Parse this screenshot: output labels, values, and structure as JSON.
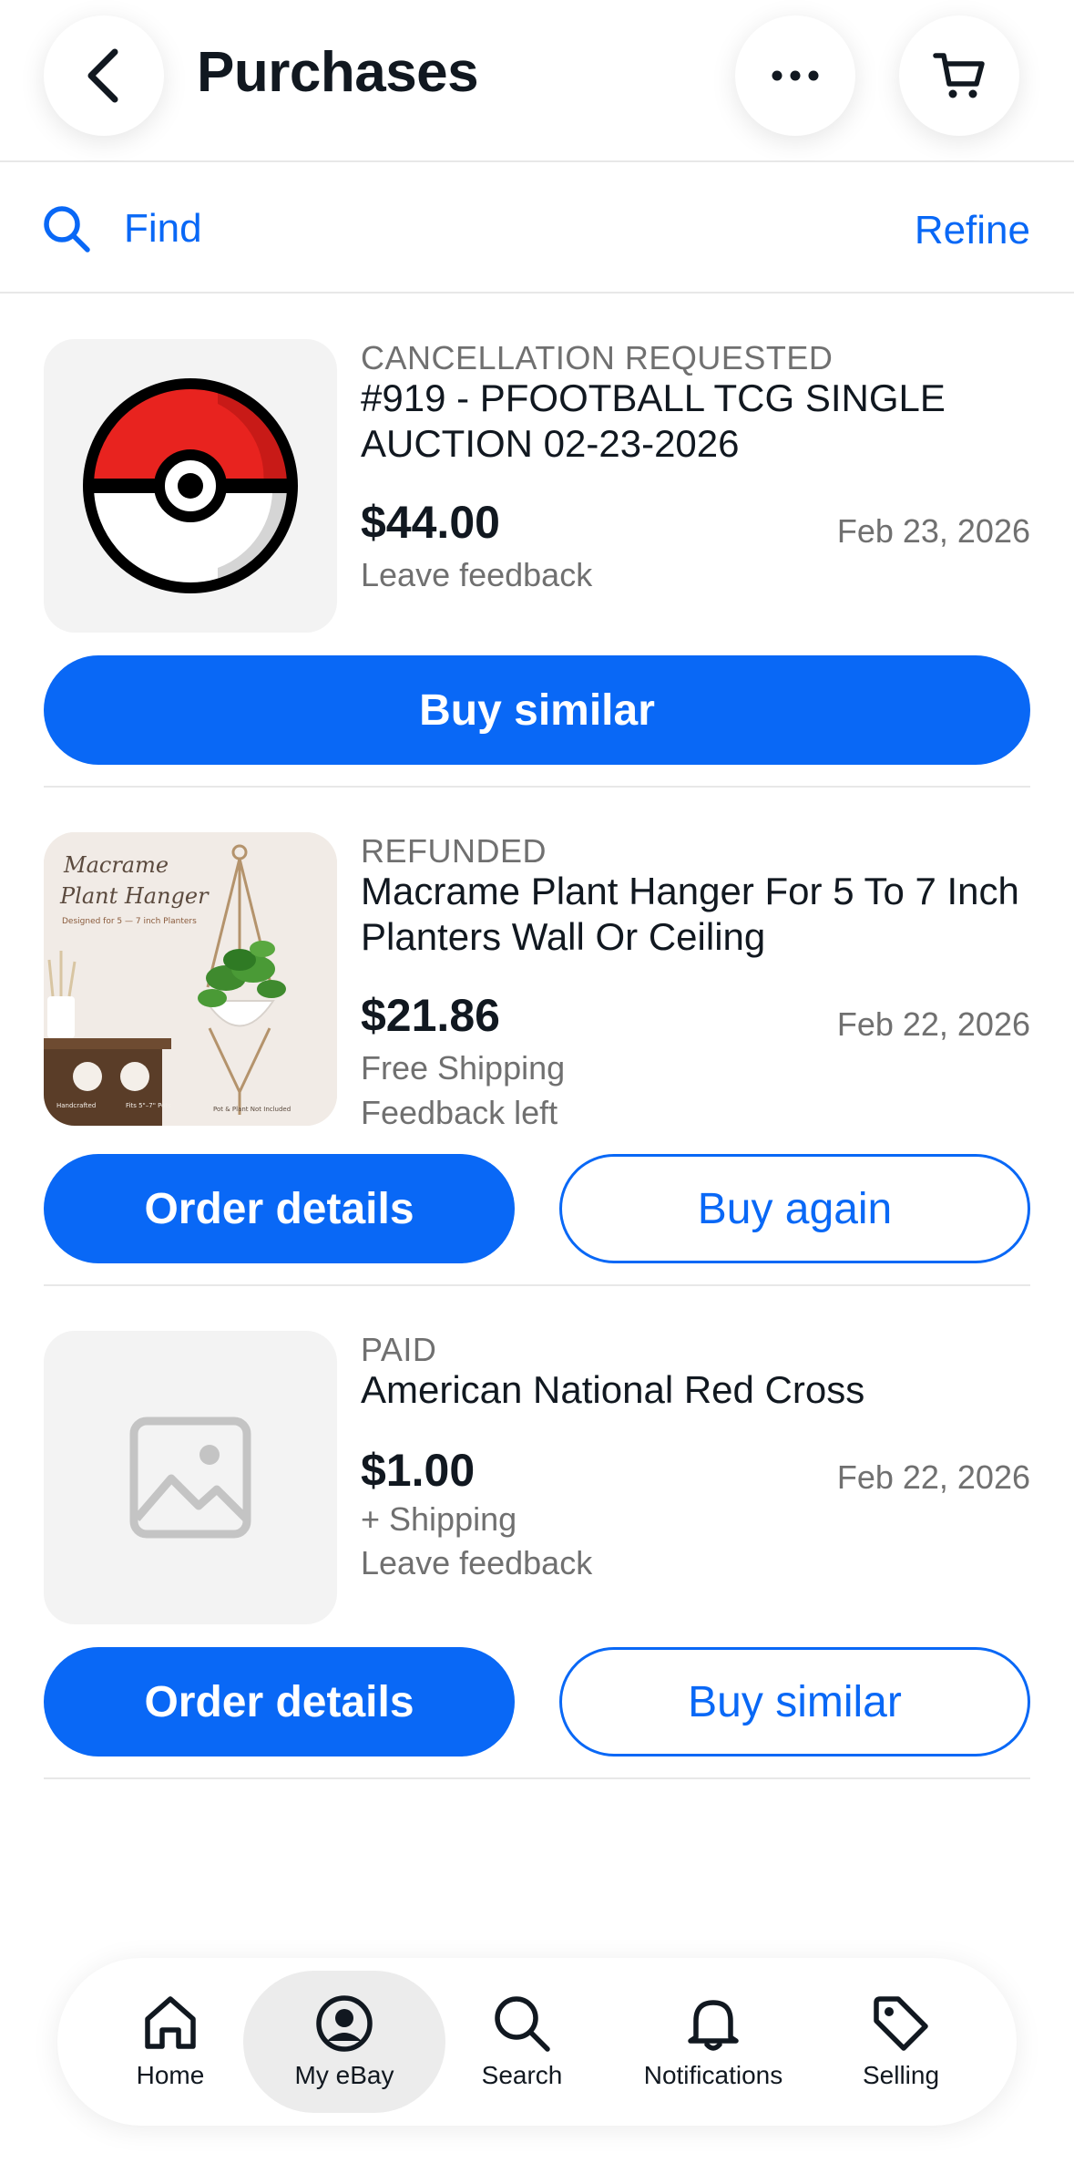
{
  "header": {
    "title": "Purchases"
  },
  "findbar": {
    "find_label": "Find",
    "refine_label": "Refine"
  },
  "orders": [
    {
      "status": "CANCELLATION REQUESTED",
      "title": "#919 - PFOOTBALL TCG SINGLE AUCTION 02-23-2026",
      "price": "$44.00",
      "date": "Feb 23, 2026",
      "lines": [
        "Leave feedback"
      ],
      "thumb_icon": "pokeball-icon",
      "primary_button": "Buy similar"
    },
    {
      "status": "REFUNDED",
      "title": "Macrame Plant Hanger For 5 To 7 Inch Planters Wall Or Ceiling",
      "price": "$21.86",
      "date": "Feb 22, 2026",
      "lines": [
        "Free Shipping",
        "Feedback left"
      ],
      "thumb": {
        "heading_line1": "Macrame",
        "heading_line2": "Plant Hanger",
        "caption": "Designed for 5 — 7 inch Planters",
        "badge1": "Handcrafted",
        "badge2": "Fits 5\"–7\" Pots",
        "badge3": "Pot & Plant Not Included"
      },
      "primary_button": "Order details",
      "secondary_button": "Buy again"
    },
    {
      "status": "PAID",
      "title": "American National Red Cross",
      "price": "$1.00",
      "date": "Feb 22, 2026",
      "lines": [
        "+ Shipping",
        "Leave feedback"
      ],
      "thumb_icon": "image-placeholder-icon",
      "primary_button": "Order details",
      "secondary_button": "Buy similar"
    }
  ],
  "bottom_nav": [
    {
      "label": "Home",
      "icon": "home-icon"
    },
    {
      "label": "My eBay",
      "icon": "profile-icon",
      "active": true
    },
    {
      "label": "Search",
      "icon": "search-icon"
    },
    {
      "label": "Notifications",
      "icon": "bell-icon"
    },
    {
      "label": "Selling",
      "icon": "tag-icon"
    }
  ],
  "colors": {
    "accent": "#0968f6",
    "text_primary": "#111820",
    "text_secondary": "#707070",
    "divider": "#e8e8e8",
    "pokeball_red": "#e8231f"
  }
}
